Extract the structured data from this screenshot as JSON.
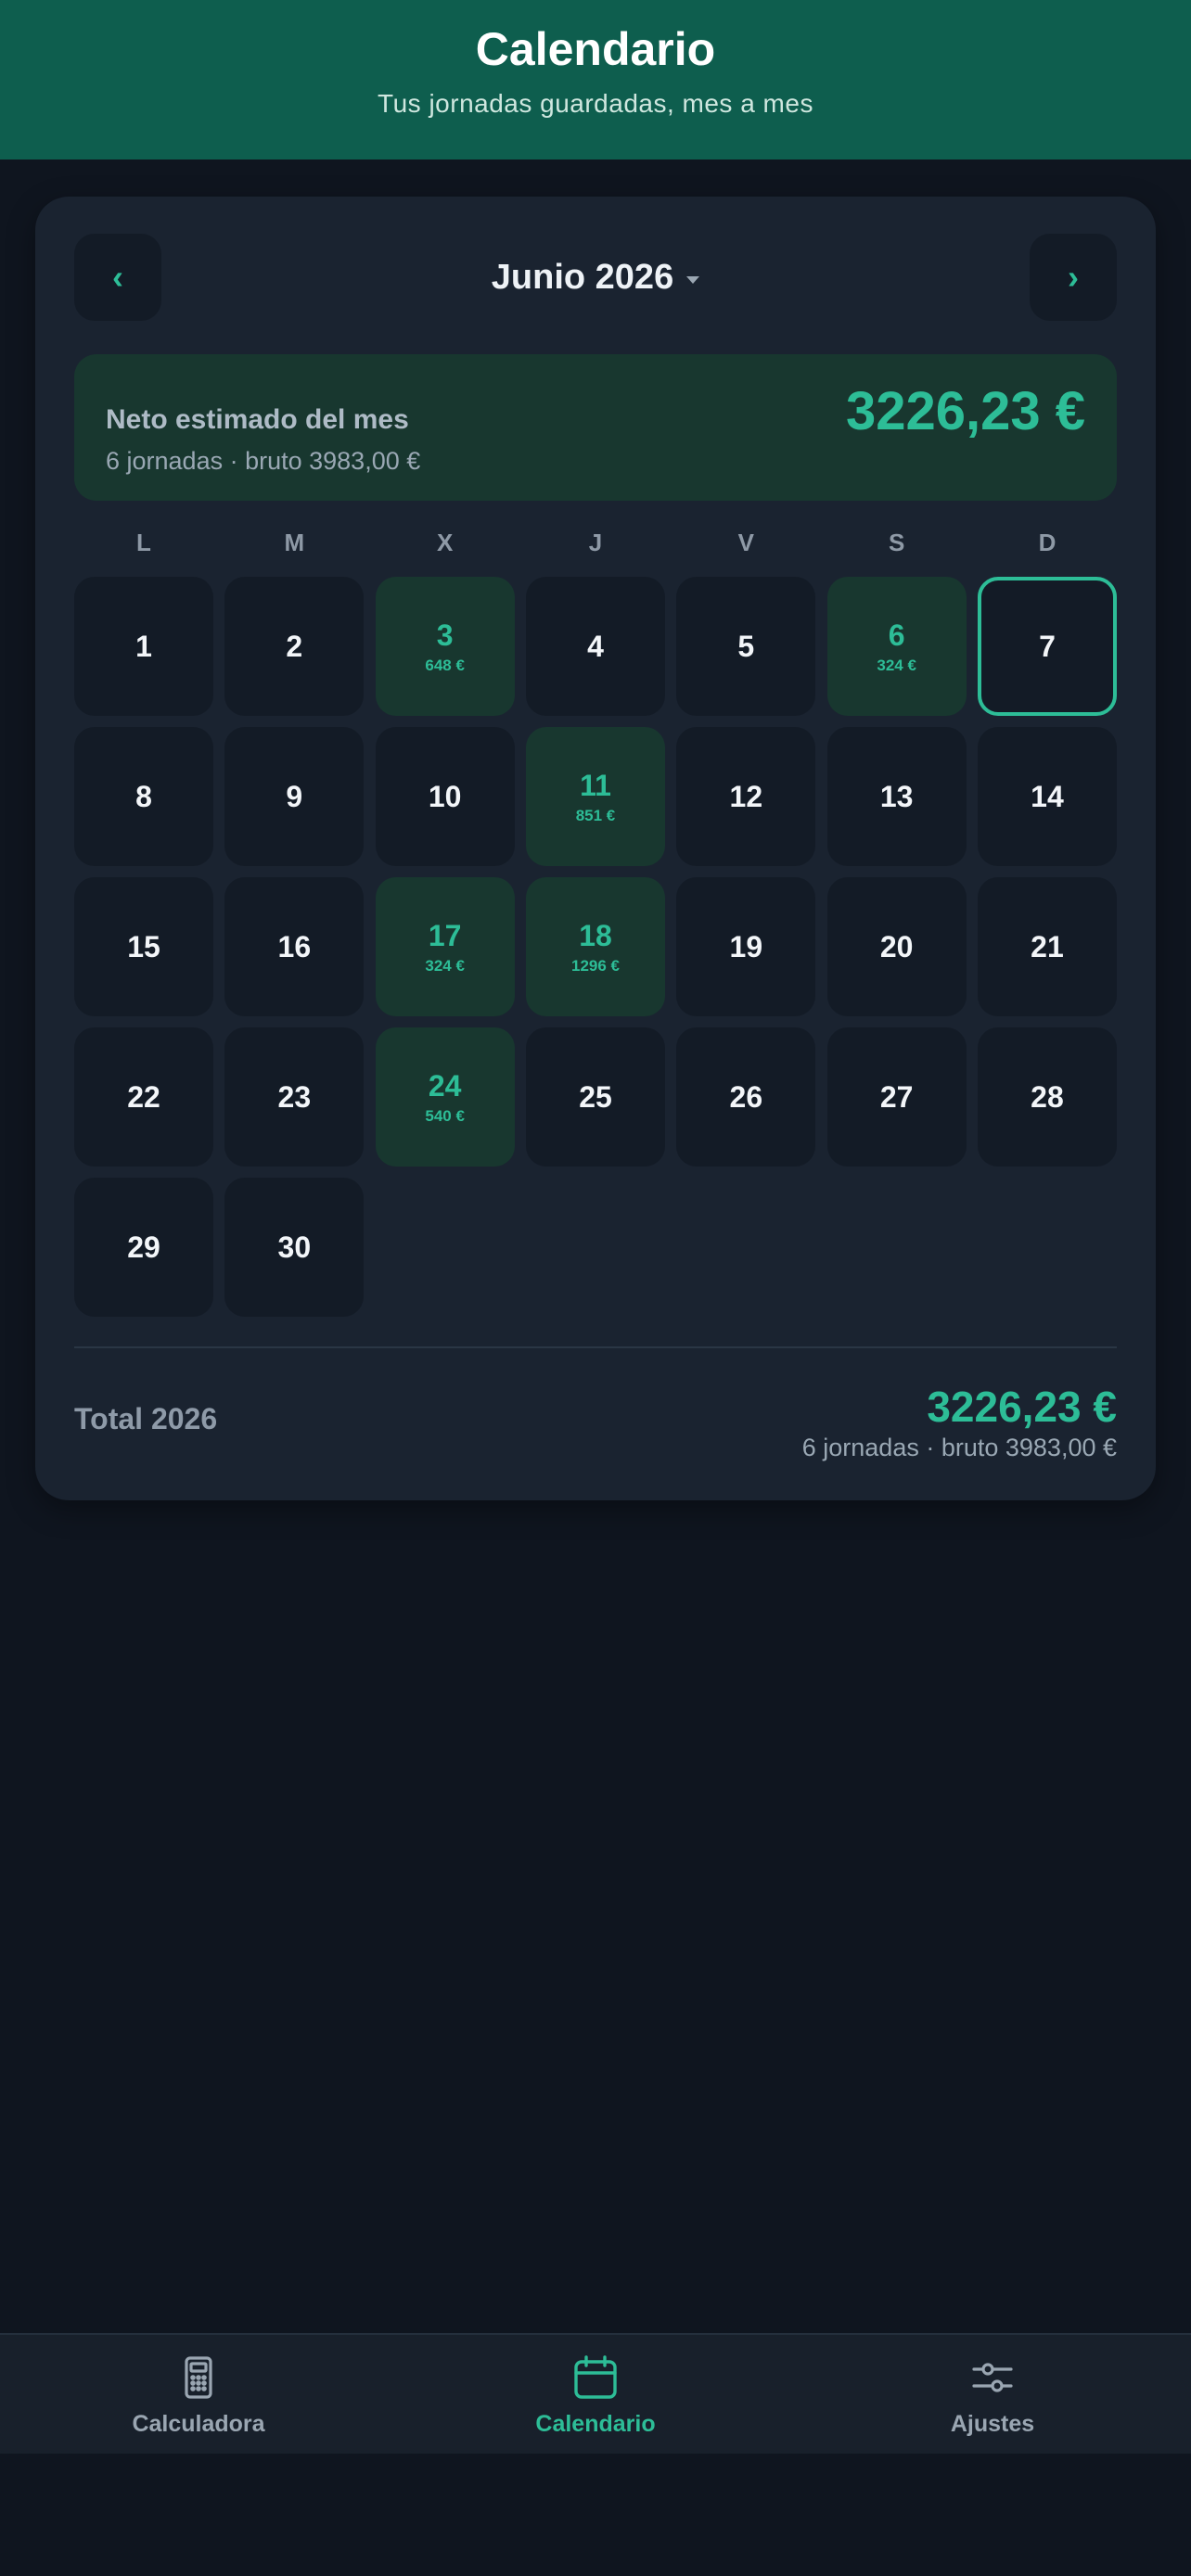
{
  "header": {
    "title": "Calendario",
    "subtitle": "Tus jornadas guardadas, mes a mes"
  },
  "calendar": {
    "prev_icon": "‹",
    "next_icon": "›",
    "month_label": "Junio 2026",
    "summary": {
      "label": "Neto estimado del mes",
      "meta": "6 jornadas · bruto 3983,00 €",
      "amount": "3226,23 €"
    },
    "weekdays": [
      "L",
      "M",
      "X",
      "J",
      "V",
      "S",
      "D"
    ],
    "days": [
      {
        "n": "1"
      },
      {
        "n": "2"
      },
      {
        "n": "3",
        "amt": "648 €"
      },
      {
        "n": "4"
      },
      {
        "n": "5"
      },
      {
        "n": "6",
        "amt": "324 €"
      },
      {
        "n": "7",
        "today": true
      },
      {
        "n": "8"
      },
      {
        "n": "9"
      },
      {
        "n": "10"
      },
      {
        "n": "11",
        "amt": "851 €"
      },
      {
        "n": "12"
      },
      {
        "n": "13"
      },
      {
        "n": "14"
      },
      {
        "n": "15"
      },
      {
        "n": "16"
      },
      {
        "n": "17",
        "amt": "324 €"
      },
      {
        "n": "18",
        "amt": "1296 €"
      },
      {
        "n": "19"
      },
      {
        "n": "20"
      },
      {
        "n": "21"
      },
      {
        "n": "22"
      },
      {
        "n": "23"
      },
      {
        "n": "24",
        "amt": "540 €"
      },
      {
        "n": "25"
      },
      {
        "n": "26"
      },
      {
        "n": "27"
      },
      {
        "n": "28"
      },
      {
        "n": "29"
      },
      {
        "n": "30"
      }
    ],
    "total": {
      "label": "Total 2026",
      "amount": "3226,23 €",
      "meta": "6 jornadas · bruto 3983,00 €"
    }
  },
  "tabbar": {
    "items": [
      {
        "label": "Calculadora",
        "icon": "calculator-icon"
      },
      {
        "label": "Calendario",
        "icon": "calendar-icon",
        "active": true
      },
      {
        "label": "Ajustes",
        "icon": "sliders-icon"
      }
    ]
  },
  "colors": {
    "accent": "#2dbd97",
    "header_bg": "#0e5e4e",
    "background": "#0f151f",
    "card": "#1a2330",
    "worked_day": "#18372f"
  }
}
